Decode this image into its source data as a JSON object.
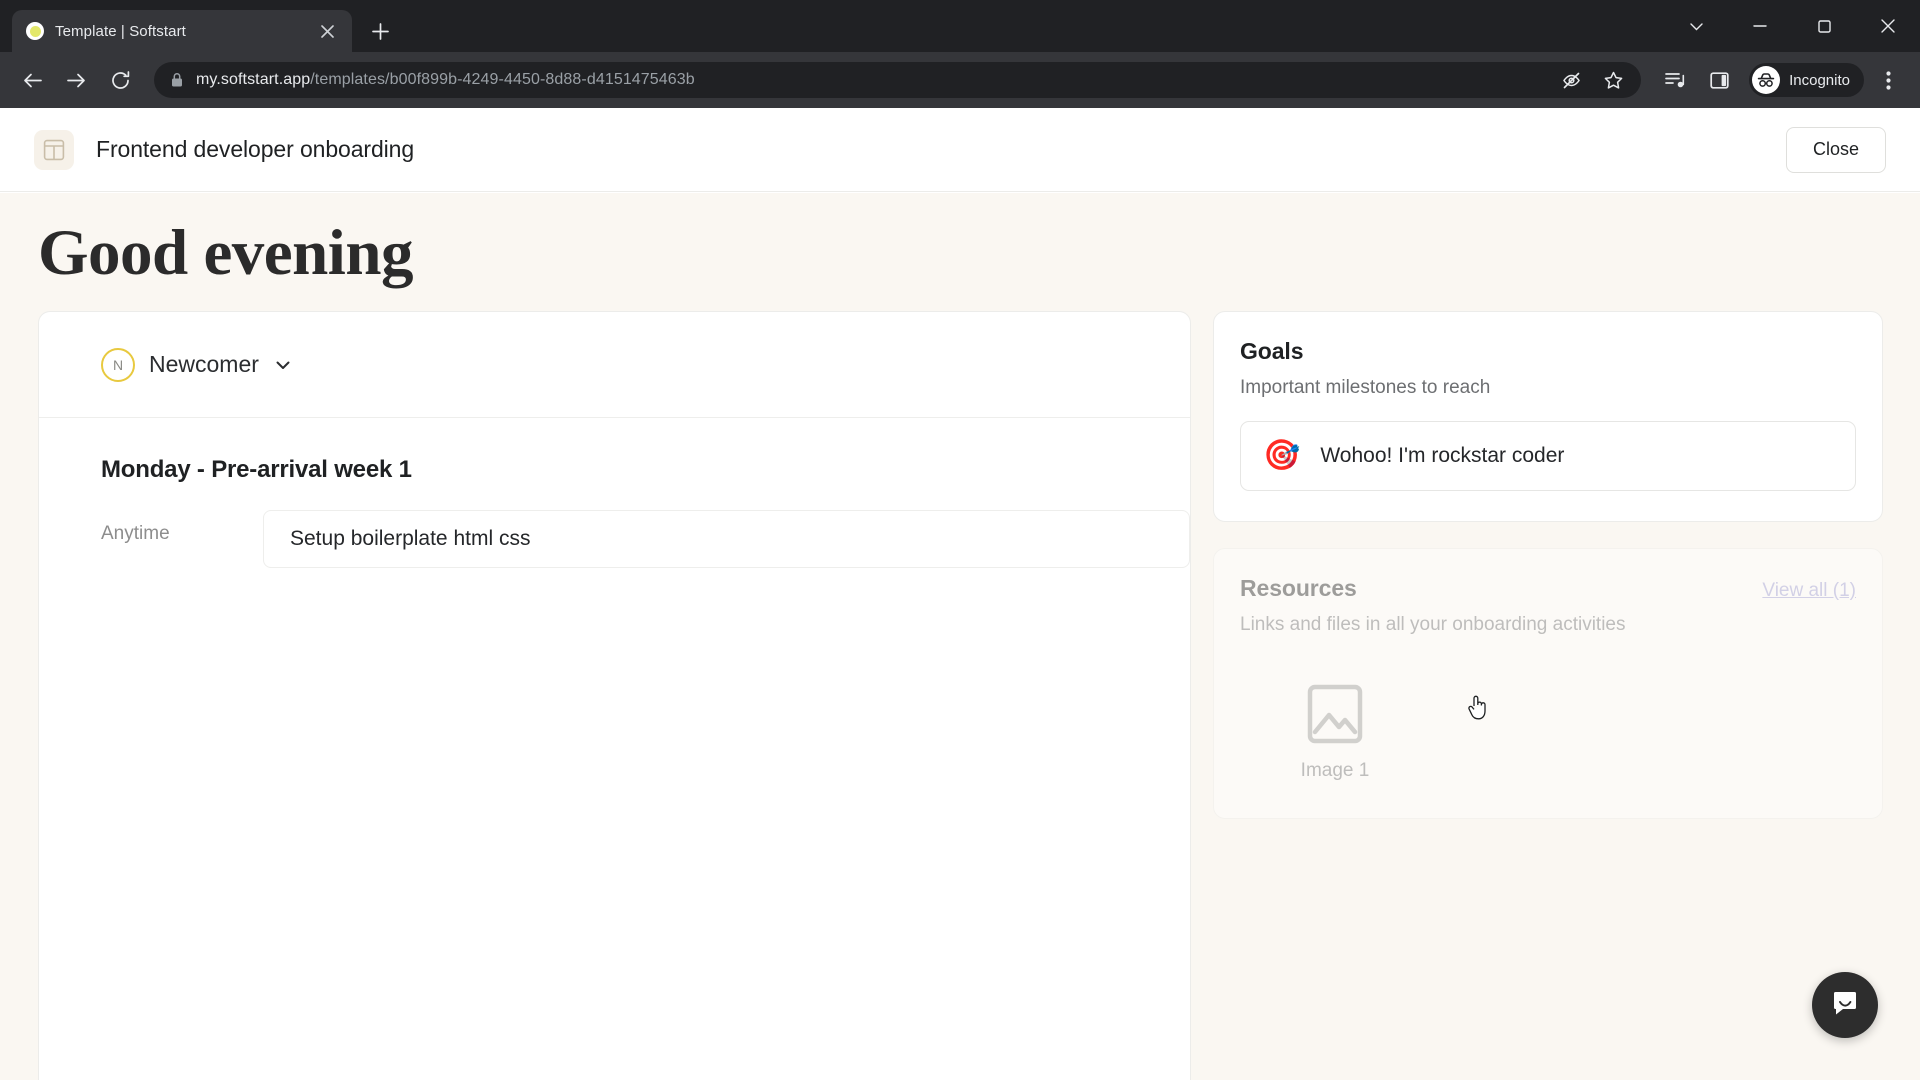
{
  "browser": {
    "tab": {
      "title": "Template | Softstart",
      "favicon": "softstart-favicon",
      "close_icon": "close-icon"
    },
    "new_tab_label": "+",
    "window_controls": [
      "minimize-all-icon",
      "minimize-icon",
      "maximize-icon",
      "close-window-icon"
    ],
    "nav": {
      "back_icon": "back-arrow-icon",
      "forward_icon": "forward-arrow-icon",
      "reload_icon": "reload-icon"
    },
    "omnibox": {
      "lock_icon": "lock-icon",
      "url_domain": "my.softstart.app",
      "url_path": "/templates/b00f899b-4249-4450-8d88-d4151475463b",
      "tracking_icon": "eye-slash-icon",
      "bookmark_icon": "star-icon"
    },
    "toolbar_right": {
      "media_icon": "media-playlist-icon",
      "side_panel_icon": "side-panel-icon",
      "profile_label": "Incognito",
      "profile_icon": "incognito-avatar-icon",
      "menu_icon": "three-dot-menu-icon"
    }
  },
  "app": {
    "logo_icon": "template-layout-icon",
    "title": "Frontend developer onboarding",
    "close_label": "Close"
  },
  "page": {
    "greeting": "Good evening",
    "decorations": [
      "dashed-cloud-small",
      "dashed-cloud-large"
    ]
  },
  "persona": {
    "initial": "N",
    "name": "Newcomer",
    "chevron_icon": "chevron-down-icon"
  },
  "schedule": {
    "day_title": "Monday - Pre-arrival week 1",
    "tasks": [
      {
        "when": "Anytime",
        "title": "Setup boilerplate html css"
      }
    ]
  },
  "goals": {
    "title": "Goals",
    "subtitle": "Important milestones to reach",
    "items": [
      {
        "emoji": "🎯",
        "text": "Wohoo! I'm rockstar coder"
      }
    ]
  },
  "resources": {
    "title": "Resources",
    "view_all_label": "View all (1)",
    "subtitle": "Links and files in all your onboarding activities",
    "items": [
      {
        "icon": "image-placeholder-icon",
        "label": "Image 1"
      }
    ]
  },
  "chat": {
    "icon": "chat-bubble-smile-icon"
  },
  "colors": {
    "canvas": "#faf7f2",
    "accent_link": "#9c9cd6",
    "persona_ring": "#e8c93f",
    "chrome_dark": "#35363a"
  }
}
